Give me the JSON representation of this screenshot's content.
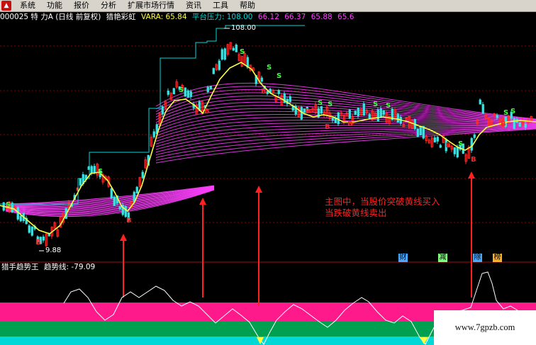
{
  "menu": {
    "items": [
      "系统",
      "功能",
      "报价",
      "分析",
      "扩展市场行情",
      "资讯",
      "工具",
      "帮助"
    ]
  },
  "info": {
    "code_title": "000025 特 力A (日线 前复权)",
    "indicator_name": "猎艳彩虹",
    "vara_label": "VARA: 65.84",
    "platform_label": "平台压力: 108.00",
    "value_1": "66.12",
    "value_2": "66.37",
    "value_3": "65.88",
    "value_4": "65.6"
  },
  "main_chart": {
    "high_label": "108.00",
    "low_label": "9.88",
    "buy_marker": "B",
    "sell_marker": "S"
  },
  "annotation": {
    "line1": "主图中，当股价突破黄线买入",
    "line2": "当跌破黄线卖出"
  },
  "sub_chart": {
    "name": "猎手趋势王",
    "trend_label": "趋势线: -79.09"
  },
  "badges": [
    {
      "text": "财",
      "color": "#4aa8ff"
    },
    {
      "text": "减",
      "color": "#7dff7d"
    },
    {
      "text": "除",
      "color": "#4aa8ff"
    },
    {
      "text": "榜",
      "color": "#ffb020"
    }
  ],
  "colors": {
    "background": "#000000",
    "price_line": "#00d8d8",
    "ma_line": "#ffff40",
    "rainbow": "#ff40ff",
    "arrow": "#ff2020",
    "band_top": "#ff1a8c",
    "band_mid": "#00a050",
    "band_bottom": "#00d8d8",
    "grid": "#8b0000"
  },
  "watermark": "www.7gpzb.com"
}
